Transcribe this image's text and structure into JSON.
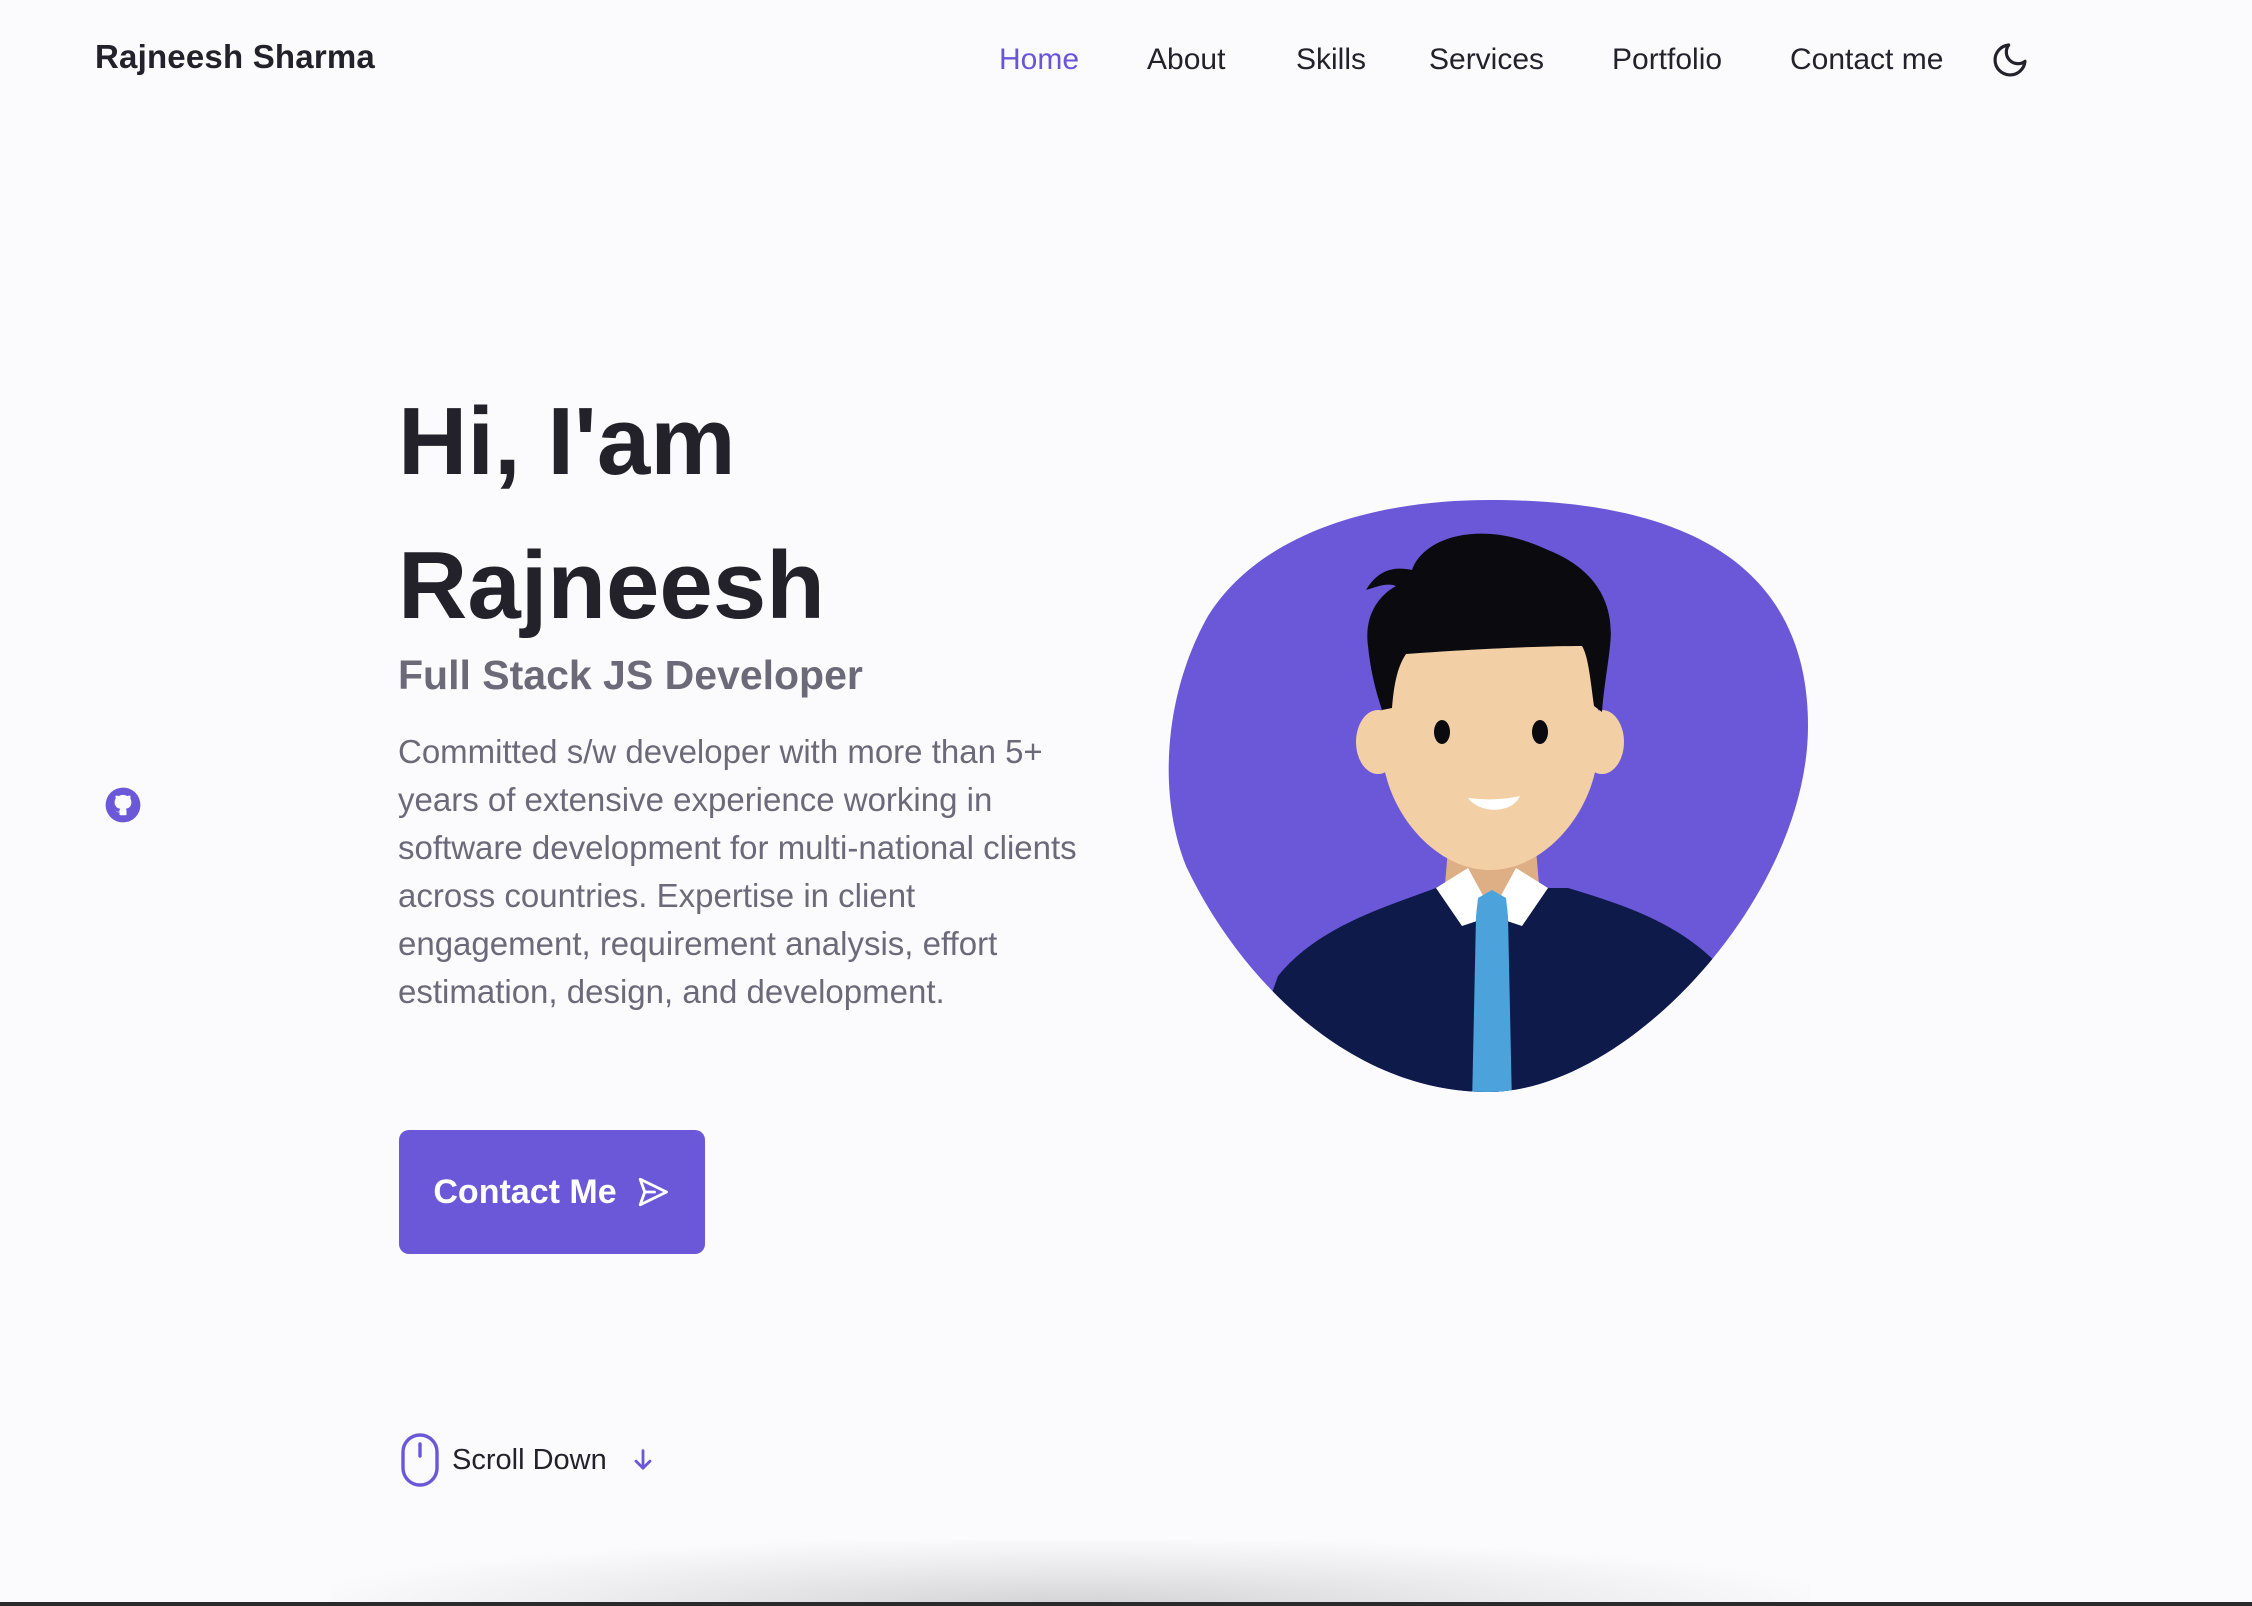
{
  "header": {
    "brand": "Rajneesh Sharma",
    "nav": [
      {
        "label": "Home",
        "active": true
      },
      {
        "label": "About",
        "active": false
      },
      {
        "label": "Skills",
        "active": false
      },
      {
        "label": "Services",
        "active": false
      },
      {
        "label": "Portfolio",
        "active": false
      },
      {
        "label": "Contact me",
        "active": false
      }
    ],
    "theme_toggle_icon": "moon-icon"
  },
  "social": {
    "icon": "github-icon"
  },
  "hero": {
    "title_line1": "Hi, I'am",
    "title_line2": "Rajneesh",
    "subtitle": "Full Stack JS Developer",
    "description": "Committed s/w developer with more than 5+ years of extensive experience working in software development for multi-national clients across countries. Expertise in client engagement, requirement analysis, effort estimation, design, and development.",
    "cta_label": "Contact Me",
    "cta_icon": "send-icon"
  },
  "scroll": {
    "label": "Scroll Down",
    "mouse_icon": "mouse-icon",
    "arrow_icon": "arrow-down-icon"
  },
  "colors": {
    "accent": "#6a58d9",
    "text": "#23222b",
    "muted": "#6c6a78",
    "background": "#fbfbfe"
  }
}
